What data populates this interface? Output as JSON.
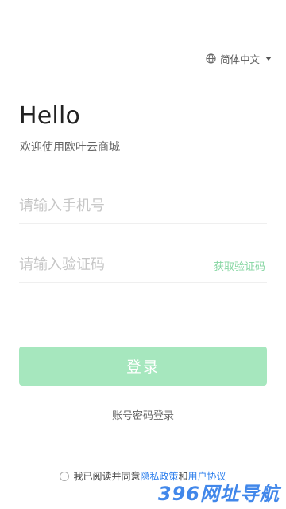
{
  "language": {
    "label": "简体中文",
    "icon": "globe-icon"
  },
  "header": {
    "title": "Hello",
    "subtitle": "欢迎使用欧叶云商城"
  },
  "form": {
    "phone_placeholder": "请输入手机号",
    "code_placeholder": "请输入验证码",
    "get_code_label": "获取验证码"
  },
  "actions": {
    "login_label": "登录",
    "password_login_label": "账号密码登录"
  },
  "agreement": {
    "prefix": "我已阅读并同意",
    "privacy": "隐私政策",
    "and": "和",
    "terms": "用户协议"
  },
  "watermark": {
    "text": "396网址导航"
  },
  "colors": {
    "primary_light": "#a6e7be",
    "link": "#2f80ed",
    "accent_text": "#86d6a2"
  }
}
